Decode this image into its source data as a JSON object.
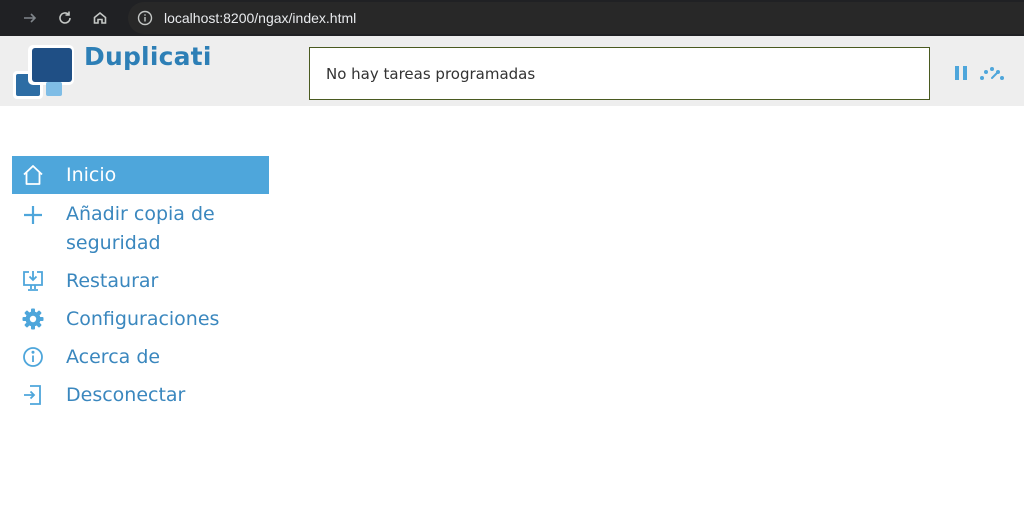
{
  "browser": {
    "url": "localhost:8200/ngax/index.html"
  },
  "app": {
    "name": "Duplicati",
    "status": "No hay tareas programadas"
  },
  "sidebar": {
    "items": [
      {
        "label": "Inicio",
        "icon": "home-icon",
        "active": true
      },
      {
        "label": "Añadir copia de seguridad",
        "icon": "plus-icon"
      },
      {
        "label": "Restaurar",
        "icon": "restore-icon"
      },
      {
        "label": "Configuraciones",
        "icon": "gear-icon"
      },
      {
        "label": "Acerca de",
        "icon": "info-icon"
      },
      {
        "label": "Desconectar",
        "icon": "logout-icon"
      }
    ]
  },
  "colors": {
    "accent": "#4ea6db",
    "brand": "#2d7fb6",
    "link": "#3a87be",
    "header_bg": "#eeeeee"
  }
}
